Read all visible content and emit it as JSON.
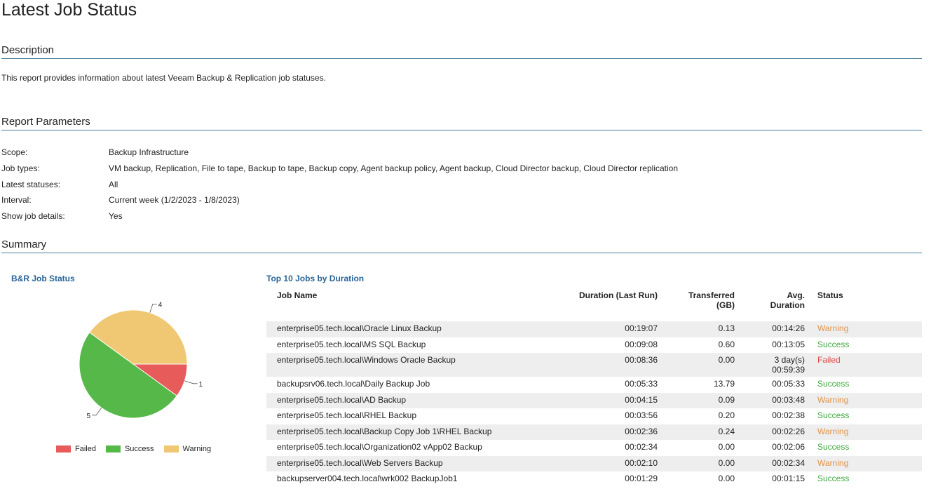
{
  "page_title": "Latest Job Status",
  "description": {
    "heading": "Description",
    "text": "This report provides information about latest Veeam Backup & Replication job statuses."
  },
  "parameters": {
    "heading": "Report Parameters",
    "rows": [
      {
        "label": "Scope:",
        "value": "Backup Infrastructure"
      },
      {
        "label": "Job types:",
        "value": "VM backup, Replication, File to tape, Backup to tape, Backup copy, Agent backup policy, Agent backup, Cloud Director backup, Cloud Director replication"
      },
      {
        "label": "Latest statuses:",
        "value": "All"
      },
      {
        "label": "Interval:",
        "value": "Current week (1/2/2023 - 1/8/2023)"
      },
      {
        "label": "Show job details:",
        "value": "Yes"
      }
    ]
  },
  "summary": {
    "heading": "Summary",
    "chart_title": "B&R Job Status",
    "table_title": "Top 10 Jobs by Duration"
  },
  "chart_data": {
    "type": "pie",
    "title": "B&R Job Status",
    "slices": [
      {
        "label": "Failed",
        "value": 1,
        "color": "#e85b5b"
      },
      {
        "label": "Success",
        "value": 5,
        "color": "#55b848"
      },
      {
        "label": "Warning",
        "value": 4,
        "color": "#f0c772"
      }
    ],
    "legend_position": "bottom"
  },
  "table": {
    "headers": {
      "job_name": "Job Name",
      "duration": "Duration (Last Run)",
      "transferred": [
        "Transferred",
        "(GB)"
      ],
      "avg_duration": [
        "Avg.",
        "Duration"
      ],
      "status": "Status"
    },
    "rows": [
      {
        "name": "enterprise05.tech.local\\Oracle Linux Backup",
        "duration": "00:19:07",
        "transferred": "0.13",
        "avg": [
          "00:14:26"
        ],
        "status": "Warning"
      },
      {
        "name": "enterprise05.tech.local\\MS SQL Backup",
        "duration": "00:09:08",
        "transferred": "0.60",
        "avg": [
          "00:13:05"
        ],
        "status": "Success"
      },
      {
        "name": "enterprise05.tech.local\\Windows Oracle Backup",
        "duration": "00:08:36",
        "transferred": "0.00",
        "avg": [
          "3 day(s)",
          "00:59:39"
        ],
        "status": "Failed"
      },
      {
        "name": "backupsrv06.tech.local\\Daily Backup Job",
        "duration": "00:05:33",
        "transferred": "13.79",
        "avg": [
          "00:05:33"
        ],
        "status": "Success"
      },
      {
        "name": "enterprise05.tech.local\\AD Backup",
        "duration": "00:04:15",
        "transferred": "0.09",
        "avg": [
          "00:03:48"
        ],
        "status": "Warning"
      },
      {
        "name": "enterprise05.tech.local\\RHEL Backup",
        "duration": "00:03:56",
        "transferred": "0.20",
        "avg": [
          "00:02:38"
        ],
        "status": "Success"
      },
      {
        "name": "enterprise05.tech.local\\Backup Copy Job 1\\RHEL Backup",
        "duration": "00:02:36",
        "transferred": "0.24",
        "avg": [
          "00:02:26"
        ],
        "status": "Warning"
      },
      {
        "name": "enterprise05.tech.local\\Organization02 vApp02 Backup",
        "duration": "00:02:34",
        "transferred": "0.00",
        "avg": [
          "00:02:06"
        ],
        "status": "Success"
      },
      {
        "name": "enterprise05.tech.local\\Web Servers Backup",
        "duration": "00:02:10",
        "transferred": "0.00",
        "avg": [
          "00:02:34"
        ],
        "status": "Warning"
      },
      {
        "name": "backupserver004.tech.local\\wrk002 BackupJob1",
        "duration": "00:01:29",
        "transferred": "0.00",
        "avg": [
          "00:01:15"
        ],
        "status": "Success"
      }
    ]
  },
  "status_colors": {
    "Warning": "#e0944a",
    "Success": "#3fa83f",
    "Failed": "#e04848"
  }
}
